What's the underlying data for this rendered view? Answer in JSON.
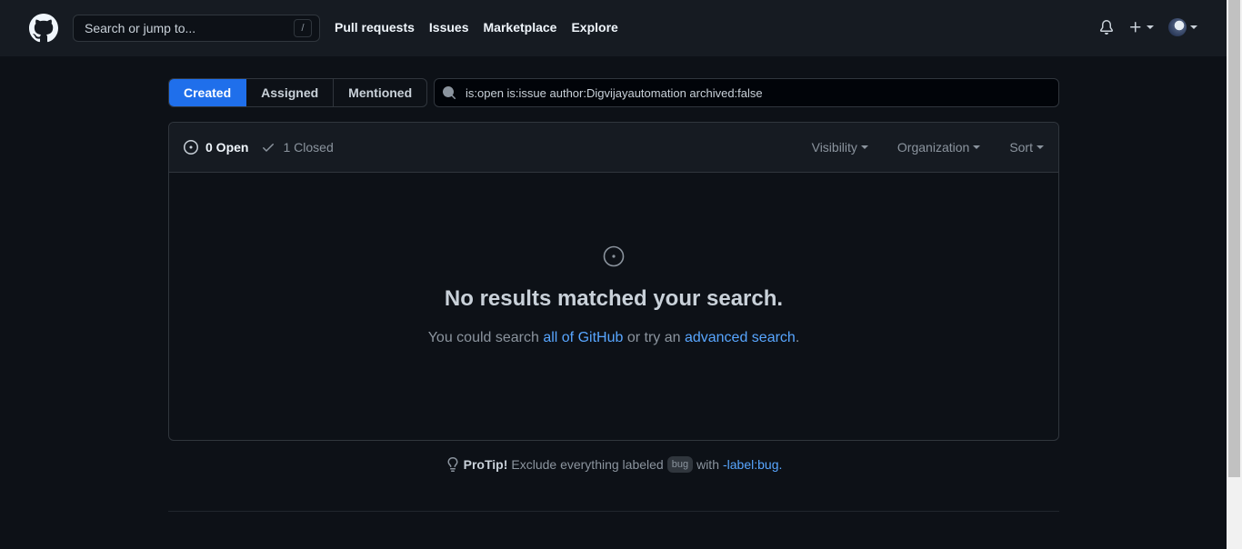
{
  "header": {
    "search_placeholder": "Search or jump to...",
    "slash_key": "/",
    "nav": [
      "Pull requests",
      "Issues",
      "Marketplace",
      "Explore"
    ]
  },
  "tabs": [
    "Created",
    "Assigned",
    "Mentioned"
  ],
  "filter_query": "is:open is:issue author:Digvijayautomation archived:false",
  "issues": {
    "open_label": "0 Open",
    "closed_label": "1 Closed",
    "dropdowns": [
      "Visibility",
      "Organization",
      "Sort"
    ]
  },
  "blank": {
    "title": "No results matched your search.",
    "text_1": "You could search ",
    "link_1": "all of GitHub",
    "text_2": " or try an ",
    "link_2": "advanced search",
    "text_3": "."
  },
  "protip": {
    "strong": "ProTip!",
    "text_1": "Exclude everything labeled",
    "label": "bug",
    "text_2": "with",
    "link": "-label:bug",
    "end": "."
  },
  "colors": {
    "accent": "#1f6feb",
    "link": "#58a6ff",
    "bg": "#0d1117"
  }
}
